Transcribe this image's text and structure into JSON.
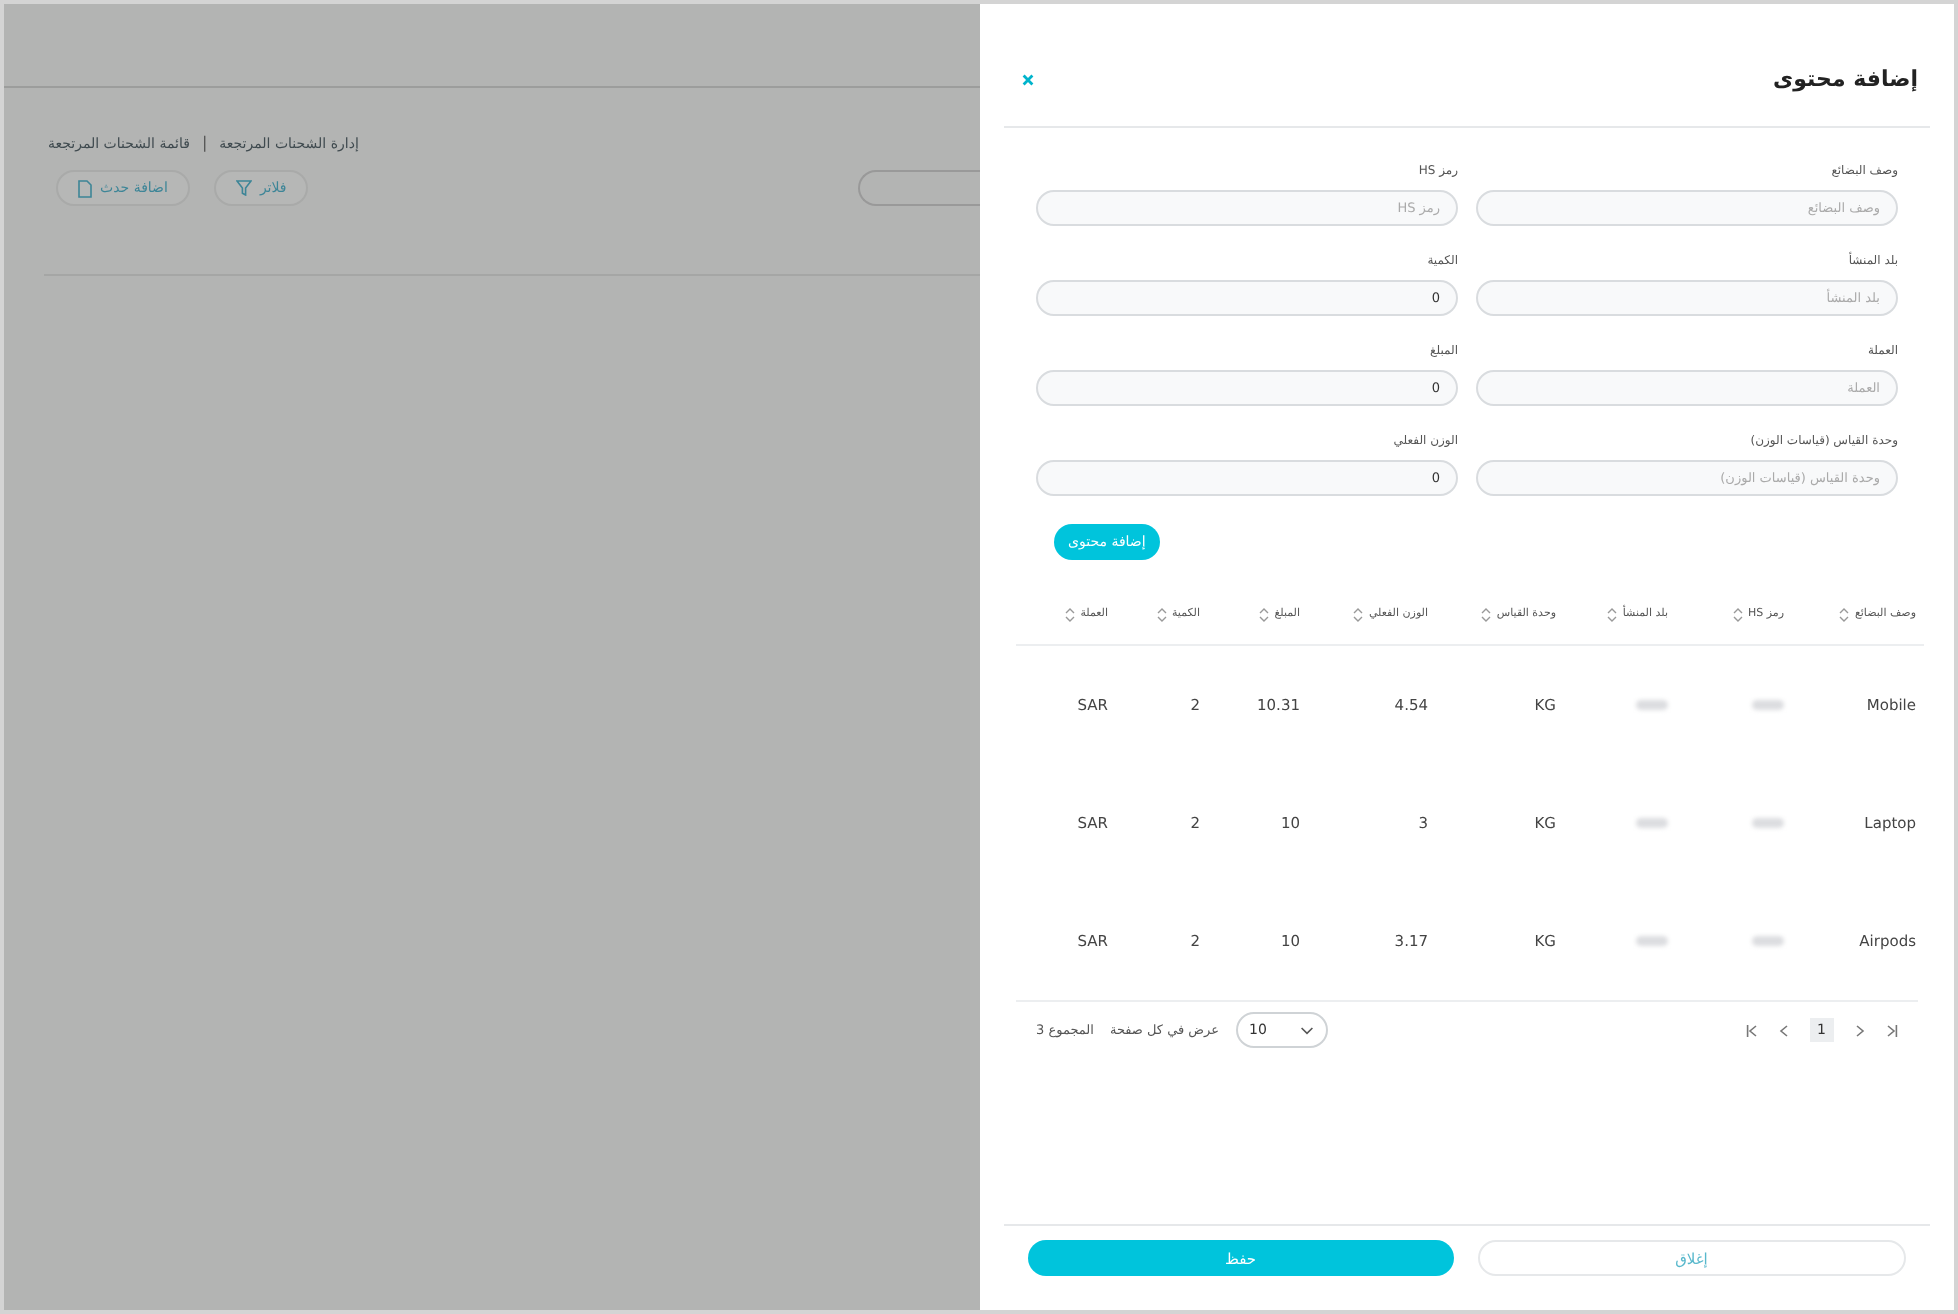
{
  "background": {
    "breadcrumb": [
      "إدارة الشحنات المرتجعة",
      "قائمة الشحنات المرتجعة"
    ],
    "breadcrumb_separator": "|",
    "buttons": [
      {
        "label": "فلاتر",
        "kind": "filter"
      },
      {
        "label": "اضافة حدث",
        "kind": "add"
      }
    ]
  },
  "drawer": {
    "title": "إضافة محتوى",
    "fields": [
      {
        "label": "وصف البضائع",
        "placeholder": "وصف البضائع"
      },
      {
        "label": "رمز HS",
        "placeholder": "رمز HS"
      },
      {
        "label": "بلد المنشأ",
        "placeholder": "بلد المنشأ"
      },
      {
        "label": "الكمية",
        "value": "0"
      },
      {
        "label": "العملة",
        "placeholder": "العملة"
      },
      {
        "label": "المبلغ",
        "value": "0"
      },
      {
        "label": "وحدة القياس (قياسات الوزن)",
        "placeholder": "وحدة القياس (قياسات الوزن)"
      },
      {
        "label": "الوزن الفعلي",
        "value": "0"
      }
    ],
    "add_button": "إضافة محتوى",
    "table": {
      "columns": [
        {
          "label": "وصف البضائع"
        },
        {
          "label": "رمز HS"
        },
        {
          "label": "بلد المنشأ"
        },
        {
          "label": "وحدة القياس"
        },
        {
          "label": "الوزن الفعلي"
        },
        {
          "label": "المبلغ"
        },
        {
          "label": "الكمية"
        },
        {
          "label": "العملة"
        }
      ],
      "rows": [
        [
          "Mobile",
          "",
          "",
          "KG",
          "4.54",
          "10.31",
          "2",
          "SAR"
        ],
        [
          "Laptop",
          "",
          "",
          "KG",
          "3",
          "10",
          "2",
          "SAR"
        ],
        [
          "Airpods",
          "",
          "",
          "KG",
          "3.17",
          "10",
          "2",
          "SAR"
        ]
      ]
    },
    "pagination": {
      "pages": [
        {
          "label": "1",
          "selected": true
        }
      ],
      "page_size": "10",
      "page_size_label": "عرض في كل صفحة",
      "total": "المجموع 3"
    },
    "footer": {
      "save": "حفظ",
      "close": "إغلاق"
    }
  }
}
